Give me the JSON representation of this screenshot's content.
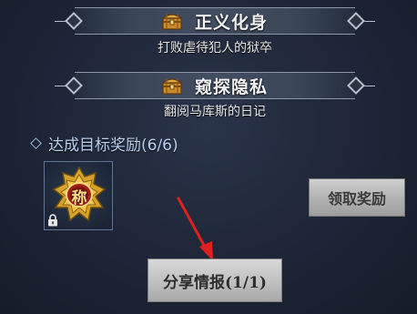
{
  "quests": [
    {
      "title": "正义化身",
      "subtitle": "打败虐待犯人的狱卒",
      "icon": "treasure-chest-icon"
    },
    {
      "title": "窥探隐私",
      "subtitle": "翻阅马库斯的日记",
      "icon": "treasure-chest-icon"
    }
  ],
  "reward_section": {
    "heading": "达成目标奖励(6/6)",
    "item_icon": "title-badge-icon",
    "item_badge_char": "称",
    "locked": true
  },
  "buttons": {
    "claim_label": "领取奖励",
    "share_label": "分享情报(1/1)"
  },
  "colors": {
    "background": "#1e2738",
    "heading_text": "#b9cfee",
    "arrow": "#e0201e",
    "badge_gold": "#d6a22a"
  }
}
